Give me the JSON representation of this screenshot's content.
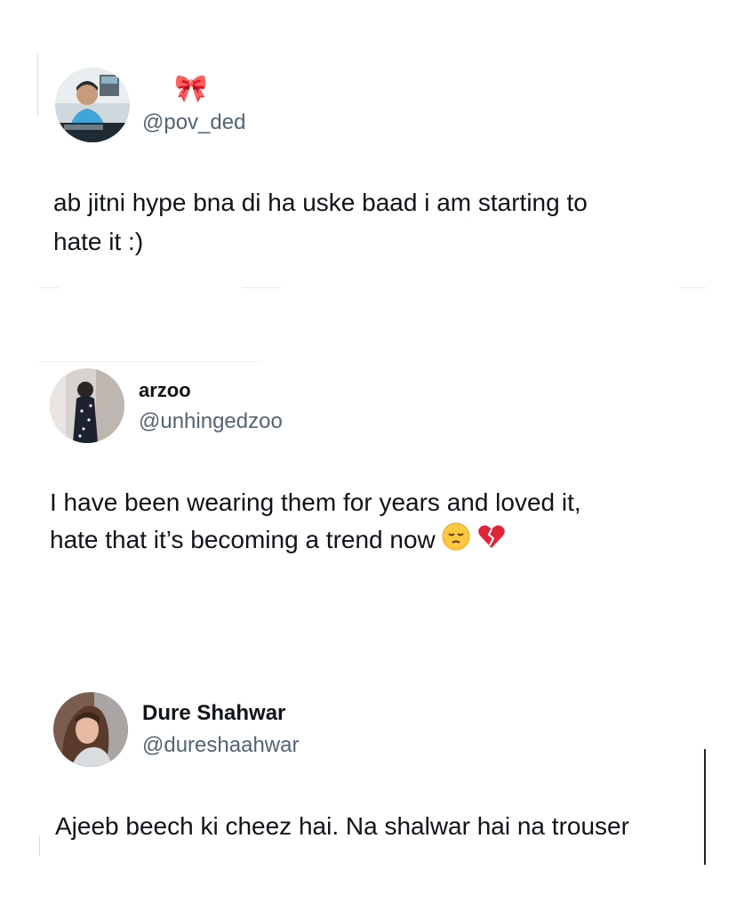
{
  "tweets": [
    {
      "display_name": "🎀",
      "handle": "@pov_ded",
      "avatar": "man-at-desk-avatar",
      "text_lines": [
        "ab jitni hype bna di ha uske baad i am starting to",
        "hate it :)"
      ]
    },
    {
      "display_name": "arzoo",
      "handle": "@unhingedzoo",
      "avatar": "woman-mirror-selfie-avatar",
      "text_lines": [
        "I have been wearing them for years and loved it,",
        "hate that it’s becoming a trend now"
      ],
      "emojis": [
        "pensive-face-emoji",
        "broken-heart-emoji"
      ]
    },
    {
      "display_name": "Dure Shahwar",
      "handle": "@dureshaahwar",
      "avatar": "woman-portrait-avatar",
      "text_lines": [
        "Ajeeb beech ki cheez hai. Na shalwar hai na trouser"
      ]
    }
  ],
  "colors": {
    "text": "#0f1419",
    "handle": "#536471",
    "ribbon": "#f5a0b4"
  }
}
